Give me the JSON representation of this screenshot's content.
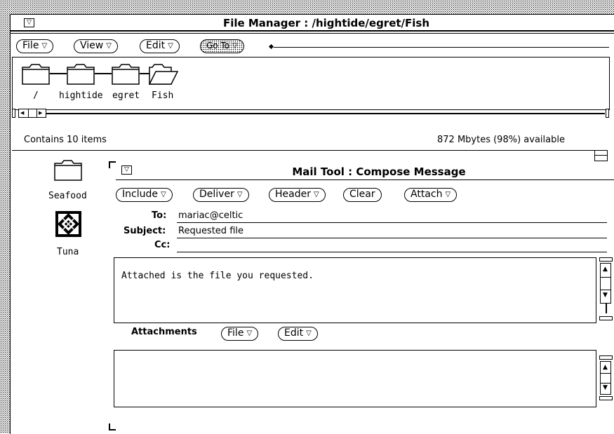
{
  "file_manager": {
    "title": "File Manager : /hightide/egret/Fish",
    "menus": {
      "file": "File",
      "view": "View",
      "edit": "Edit",
      "goto": "Go To"
    },
    "path_folders": [
      "/",
      "hightide",
      "egret",
      "Fish"
    ],
    "status_left": "Contains 10 items",
    "status_right": "872 Mbytes (98%) available",
    "items": [
      {
        "label": "Seafood",
        "icon": "folder-icon"
      },
      {
        "label": "Tuna",
        "icon": "document-icon"
      }
    ]
  },
  "mail_tool": {
    "title": "Mail Tool : Compose Message",
    "buttons": {
      "include": "Include",
      "deliver": "Deliver",
      "header": "Header",
      "clear": "Clear",
      "attach": "Attach"
    },
    "fields": {
      "to_label": "To:",
      "to_value": "mariac@celtic",
      "subject_label": "Subject:",
      "subject_value": "Requested file",
      "cc_label": "Cc:",
      "cc_value": ""
    },
    "body_text": "Attached is the file you requested.",
    "attachments": {
      "label": "Attachments",
      "file": "File",
      "edit": "Edit"
    }
  },
  "glyphs": {
    "menu_tri": "▽",
    "up_arrow": "▲",
    "down_arrow": "▼",
    "left_arrow": "◀",
    "right_arrow": "▶"
  }
}
